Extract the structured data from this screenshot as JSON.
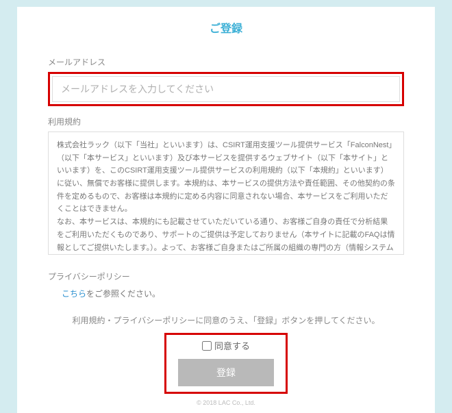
{
  "title": "ご登録",
  "email": {
    "label": "メールアドレス",
    "placeholder": "メールアドレスを入力してください"
  },
  "terms": {
    "label": "利用規約",
    "body": "株式会社ラック（以下「当社」といいます）は、CSIRT運用支援ツール提供サービス「FalconNest」（以下「本サービス」といいます）及び本サービスを提供するウェブサイト（以下「本サイト」といいます）を、このCSIRT運用支援ツール提供サービスの利用規約（以下「本規約」といいます）に従い、無償でお客様に提供します。本規約は、本サービスの提供方法や責任範囲、その他契約の条件を定めるもので、お客様は本規約に定める内容に同意されない場合、本サービスをご利用いただくことはできません。\nなお、本サービスは、本規約にも記載させていただいている通り、お客様ご自身の責任で分析結果をご利用いただくものであり、サポートのご提供は予定しておりません（本サイトに記載のFAQは情報としてご提供いたします。）。よって、お客様ご自身またはご所属の組織の専門の方（情報システム部門の方など）により、本サービスによる分析結果のご判断・ご対応をいただくことを前提としておりますため点ご了解ください。\n\n"
  },
  "privacy": {
    "label": "プライバシーポリシー",
    "link_text": "こちら",
    "after_text": "をご参照ください。"
  },
  "instruction": "利用規約・プライバシーポリシーに同意のうえ、「登録」ボタンを押してください。",
  "agree": {
    "label": "同意する"
  },
  "submit": {
    "label": "登録"
  },
  "footer": "© 2018 LAC Co., Ltd."
}
